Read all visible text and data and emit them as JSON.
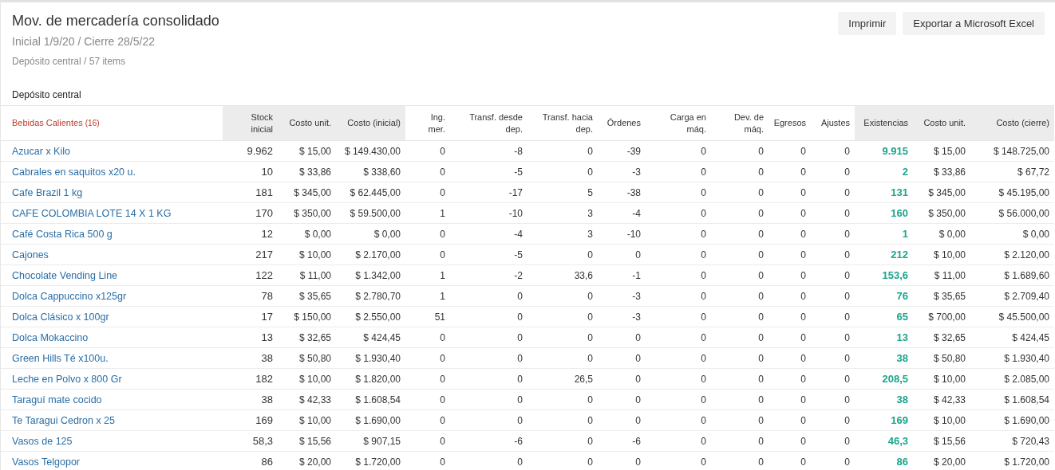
{
  "header": {
    "title": "Mov. de mercadería consolidado",
    "period": "Inicial 1/9/20 / Cierre 28/5/22",
    "subtitle": "Depósito central / 57 items"
  },
  "buttons": [
    "Imprimir",
    "Exportar a Microsoft Excel"
  ],
  "section_title": "Depósito central",
  "table": {
    "group": {
      "label": "Bebidas Calientes",
      "count": "(16)"
    },
    "columns": [
      {
        "label": "Stock inicial",
        "shaded": true,
        "kind": "number"
      },
      {
        "label": "Costo unit.",
        "shaded": true,
        "kind": "number"
      },
      {
        "label": "Costo (inicial)",
        "shaded": true,
        "kind": "number"
      },
      {
        "label": "Ing. mer.",
        "shaded": false,
        "kind": "number"
      },
      {
        "label": "Transf. desde dep.",
        "shaded": false,
        "kind": "number"
      },
      {
        "label": "Transf. hacia dep.",
        "shaded": false,
        "kind": "number"
      },
      {
        "label": "Órdenes",
        "shaded": false,
        "kind": "number"
      },
      {
        "label": "Carga en máq.",
        "shaded": false,
        "kind": "number"
      },
      {
        "label": "Dev. de máq.",
        "shaded": false,
        "kind": "number"
      },
      {
        "label": "Egresos",
        "shaded": false,
        "kind": "number"
      },
      {
        "label": "Ajustes",
        "shaded": false,
        "kind": "number"
      },
      {
        "label": "Existencias",
        "shaded": true,
        "kind": "total"
      },
      {
        "label": "Costo unit.",
        "shaded": true,
        "kind": "number"
      },
      {
        "label": "Costo (cierre)",
        "shaded": true,
        "kind": "number"
      }
    ],
    "rows": [
      {
        "name": "Azucar x Kilo",
        "cells": [
          "9.962",
          "$ 15,00",
          "$ 149.430,00",
          "0",
          "-8",
          "0",
          "-39",
          "0",
          "0",
          "0",
          "0",
          "9.915",
          "$ 15,00",
          "$ 148.725,00"
        ]
      },
      {
        "name": "Cabrales en saquitos x20 u.",
        "cells": [
          "10",
          "$ 33,86",
          "$ 338,60",
          "0",
          "-5",
          "0",
          "-3",
          "0",
          "0",
          "0",
          "0",
          "2",
          "$ 33,86",
          "$ 67,72"
        ]
      },
      {
        "name": "Cafe Brazil 1 kg",
        "cells": [
          "181",
          "$ 345,00",
          "$ 62.445,00",
          "0",
          "-17",
          "5",
          "-38",
          "0",
          "0",
          "0",
          "0",
          "131",
          "$ 345,00",
          "$ 45.195,00"
        ]
      },
      {
        "name": "CAFE COLOMBIA LOTE 14 X 1 KG",
        "cells": [
          "170",
          "$ 350,00",
          "$ 59.500,00",
          "1",
          "-10",
          "3",
          "-4",
          "0",
          "0",
          "0",
          "0",
          "160",
          "$ 350,00",
          "$ 56.000,00"
        ]
      },
      {
        "name": "Café Costa Rica 500 g",
        "cells": [
          "12",
          "$ 0,00",
          "$ 0,00",
          "0",
          "-4",
          "3",
          "-10",
          "0",
          "0",
          "0",
          "0",
          "1",
          "$ 0,00",
          "$ 0,00"
        ]
      },
      {
        "name": "Cajones",
        "cells": [
          "217",
          "$ 10,00",
          "$ 2.170,00",
          "0",
          "-5",
          "0",
          "0",
          "0",
          "0",
          "0",
          "0",
          "212",
          "$ 10,00",
          "$ 2.120,00"
        ]
      },
      {
        "name": "Chocolate Vending Line",
        "cells": [
          "122",
          "$ 11,00",
          "$ 1.342,00",
          "1",
          "-2",
          "33,6",
          "-1",
          "0",
          "0",
          "0",
          "0",
          "153,6",
          "$ 11,00",
          "$ 1.689,60"
        ]
      },
      {
        "name": "Dolca Cappuccino x125gr",
        "cells": [
          "78",
          "$ 35,65",
          "$ 2.780,70",
          "1",
          "0",
          "0",
          "-3",
          "0",
          "0",
          "0",
          "0",
          "76",
          "$ 35,65",
          "$ 2.709,40"
        ]
      },
      {
        "name": "Dolca Clásico x 100gr",
        "cells": [
          "17",
          "$ 150,00",
          "$ 2.550,00",
          "51",
          "0",
          "0",
          "-3",
          "0",
          "0",
          "0",
          "0",
          "65",
          "$ 700,00",
          "$ 45.500,00"
        ]
      },
      {
        "name": "Dolca Mokaccino",
        "cells": [
          "13",
          "$ 32,65",
          "$ 424,45",
          "0",
          "0",
          "0",
          "0",
          "0",
          "0",
          "0",
          "0",
          "13",
          "$ 32,65",
          "$ 424,45"
        ]
      },
      {
        "name": "Green Hills Té x100u.",
        "cells": [
          "38",
          "$ 50,80",
          "$ 1.930,40",
          "0",
          "0",
          "0",
          "0",
          "0",
          "0",
          "0",
          "0",
          "38",
          "$ 50,80",
          "$ 1.930,40"
        ]
      },
      {
        "name": "Leche en Polvo x 800 Gr",
        "cells": [
          "182",
          "$ 10,00",
          "$ 1.820,00",
          "0",
          "0",
          "26,5",
          "0",
          "0",
          "0",
          "0",
          "0",
          "208,5",
          "$ 10,00",
          "$ 2.085,00"
        ]
      },
      {
        "name": "Taraguí mate cocido",
        "cells": [
          "38",
          "$ 42,33",
          "$ 1.608,54",
          "0",
          "0",
          "0",
          "0",
          "0",
          "0",
          "0",
          "0",
          "38",
          "$ 42,33",
          "$ 1.608,54"
        ]
      },
      {
        "name": "Te Taragui Cedron x 25",
        "cells": [
          "169",
          "$ 10,00",
          "$ 1.690,00",
          "0",
          "0",
          "0",
          "0",
          "0",
          "0",
          "0",
          "0",
          "169",
          "$ 10,00",
          "$ 1.690,00"
        ]
      },
      {
        "name": "Vasos de 125",
        "cells": [
          "58,3",
          "$ 15,56",
          "$ 907,15",
          "0",
          "-6",
          "0",
          "-6",
          "0",
          "0",
          "0",
          "0",
          "46,3",
          "$ 15,56",
          "$ 720,43"
        ]
      },
      {
        "name": "Vasos Telgopor",
        "cells": [
          "86",
          "$ 20,00",
          "$ 1.720,00",
          "0",
          "0",
          "0",
          "0",
          "0",
          "0",
          "0",
          "0",
          "86",
          "$ 20,00",
          "$ 1.720,00"
        ]
      }
    ]
  }
}
